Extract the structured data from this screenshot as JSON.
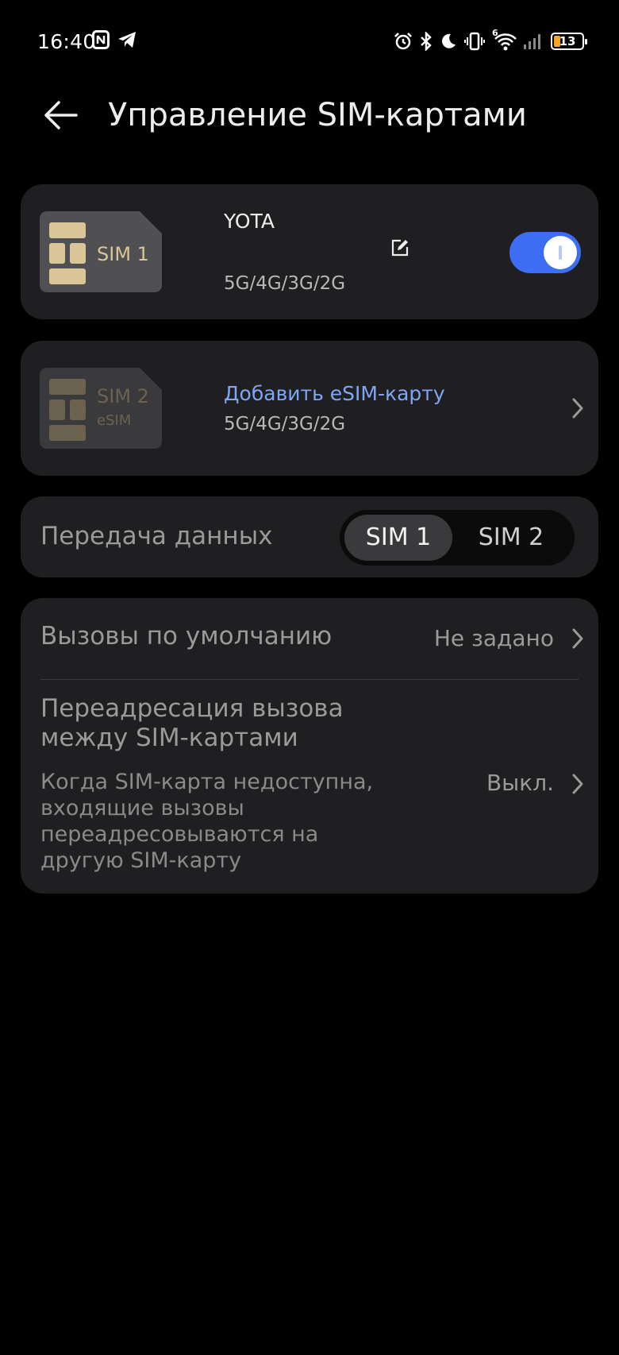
{
  "status_bar": {
    "time": "16:40",
    "left_icons": [
      "nfc-icon",
      "telegram-icon"
    ],
    "right_icons": [
      "alarm-icon",
      "bluetooth-icon",
      "moon-icon",
      "vibrate-icon",
      "wifi-icon",
      "signal-icon",
      "battery-icon"
    ],
    "wifi_badge": "6",
    "battery_level": "13",
    "battery_color": "#f5a623"
  },
  "header": {
    "title": "Управление SIM-картами"
  },
  "sim1": {
    "card_label": "SIM 1",
    "operator": "YOTA",
    "networks": "5G/4G/3G/2G",
    "enabled": true,
    "toggle_color": "#3d6df2"
  },
  "sim2": {
    "card_label": "SIM 2",
    "card_sublabel": "eSIM",
    "action": "Добавить eSIM-карту",
    "networks": "5G/4G/3G/2G",
    "action_color": "#7fa6f5"
  },
  "data_transfer": {
    "label": "Передача данных",
    "options": [
      "SIM 1",
      "SIM 2"
    ],
    "selected": "SIM 1"
  },
  "default_calls": {
    "label": "Вызовы по умолчанию",
    "value": "Не задано"
  },
  "call_forwarding": {
    "title": "Переадресация вызова между SIM-картами",
    "description": "Когда SIM-карта недоступна, входящие вызовы переадресовываются на другую SIM-карту",
    "value": "Выкл."
  }
}
